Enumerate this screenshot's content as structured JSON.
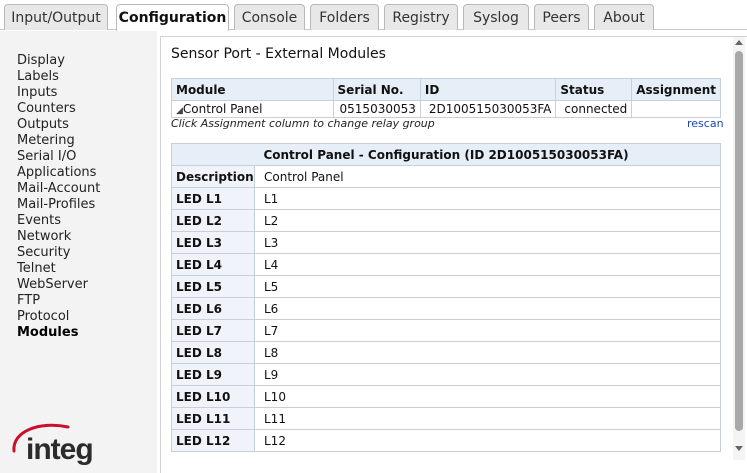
{
  "tabs": [
    {
      "label": "Input/Output"
    },
    {
      "label": "Configuration",
      "active": true
    },
    {
      "label": "Console"
    },
    {
      "label": "Folders"
    },
    {
      "label": "Registry"
    },
    {
      "label": "Syslog"
    },
    {
      "label": "Peers"
    },
    {
      "label": "About"
    }
  ],
  "sidebar": {
    "items": [
      {
        "label": "Display"
      },
      {
        "label": "Labels"
      },
      {
        "label": "Inputs"
      },
      {
        "label": "Counters"
      },
      {
        "label": "Outputs"
      },
      {
        "label": "Metering"
      },
      {
        "label": "Serial I/O"
      },
      {
        "label": "Applications"
      },
      {
        "label": "Mail-Account"
      },
      {
        "label": "Mail-Profiles"
      },
      {
        "label": "Events"
      },
      {
        "label": "Network"
      },
      {
        "label": "Security"
      },
      {
        "label": "Telnet"
      },
      {
        "label": "WebServer"
      },
      {
        "label": "FTP"
      },
      {
        "label": "Protocol"
      },
      {
        "label": "Modules",
        "active": true
      }
    ],
    "logo_text": "integ"
  },
  "main": {
    "title": "Sensor Port - External Modules",
    "modules_table": {
      "headers": {
        "module": "Module",
        "serial": "Serial No.",
        "id": "ID",
        "status": "Status",
        "assignment": "Assignment"
      },
      "rows": [
        {
          "module_icon": "expand-triangle-icon",
          "module": "Control Panel",
          "serial": "0515030053",
          "id": "2D100515030053FA",
          "status": "connected",
          "assignment": ""
        }
      ]
    },
    "hint": "Click Assignment column to change relay group",
    "rescan_label": "rescan",
    "config_table": {
      "title": "Control Panel - Configuration (ID 2D100515030053FA)",
      "rows": [
        {
          "label": "Description",
          "value": "Control Panel"
        },
        {
          "label": "LED L1",
          "value": "L1"
        },
        {
          "label": "LED L2",
          "value": "L2"
        },
        {
          "label": "LED L3",
          "value": "L3"
        },
        {
          "label": "LED L4",
          "value": "L4"
        },
        {
          "label": "LED L5",
          "value": "L5"
        },
        {
          "label": "LED L6",
          "value": "L6"
        },
        {
          "label": "LED L7",
          "value": "L7"
        },
        {
          "label": "LED L8",
          "value": "L8"
        },
        {
          "label": "LED L9",
          "value": "L9"
        },
        {
          "label": "LED L10",
          "value": "L10"
        },
        {
          "label": "LED L11",
          "value": "L11"
        },
        {
          "label": "LED L12",
          "value": "L12"
        }
      ]
    }
  },
  "colors": {
    "tab_active_bg": "#ffffff",
    "tab_bg": "#e8e8e8",
    "sidebar_bg": "#f3f3f3",
    "header_bg": "#e6eef8",
    "link": "#1a44b8",
    "logo_red": "#c8102e",
    "logo_dark": "#2b2b2b"
  }
}
